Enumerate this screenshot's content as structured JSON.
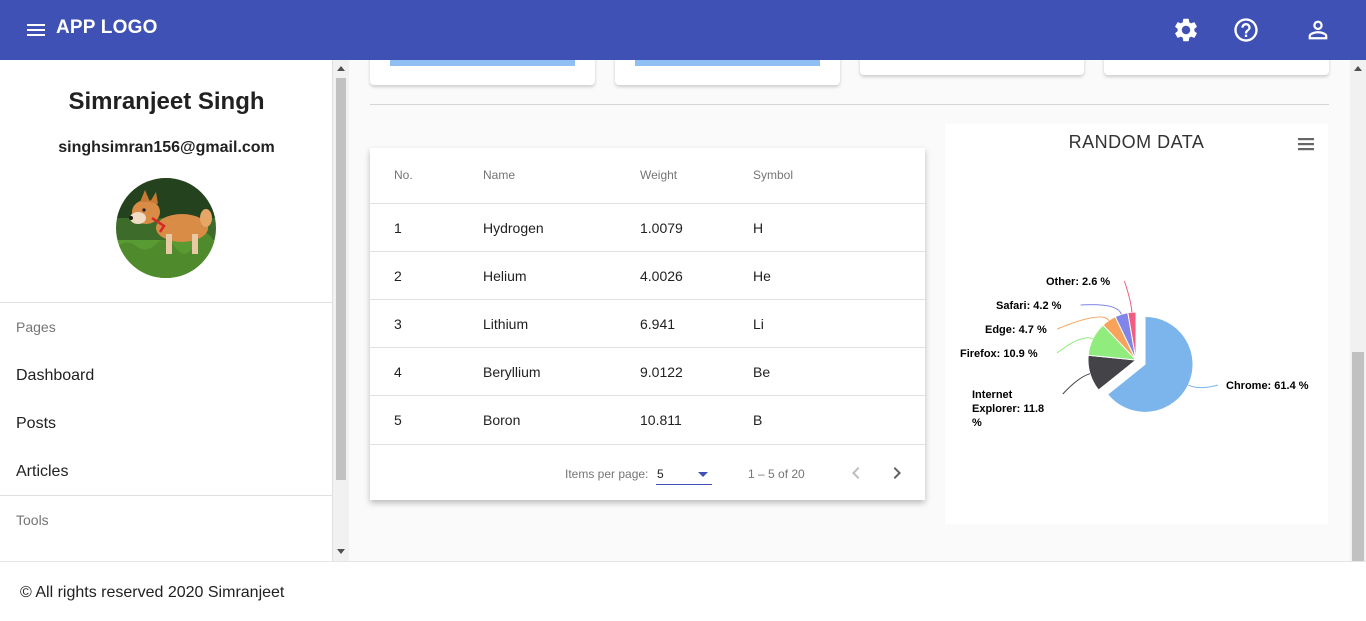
{
  "header": {
    "app_logo": "APP LOGO",
    "icons": [
      "menu-icon",
      "settings-icon",
      "help-icon",
      "account-icon"
    ],
    "color": "#3f51b5"
  },
  "sidebar": {
    "profile": {
      "name": "Simranjeet Singh",
      "email": "singhsimran156@gmail.com"
    },
    "pages_header": "Pages",
    "items": [
      "Dashboard",
      "Posts",
      "Articles"
    ],
    "tools_header": "Tools"
  },
  "table": {
    "columns": [
      "No.",
      "Name",
      "Weight",
      "Symbol"
    ],
    "rows": [
      [
        "1",
        "Hydrogen",
        "1.0079",
        "H"
      ],
      [
        "2",
        "Helium",
        "4.0026",
        "He"
      ],
      [
        "3",
        "Lithium",
        "6.941",
        "Li"
      ],
      [
        "4",
        "Beryllium",
        "9.0122",
        "Be"
      ],
      [
        "5",
        "Boron",
        "10.811",
        "B"
      ]
    ],
    "paginator": {
      "label": "Items per page:",
      "page_size": "5",
      "range": "1 – 5 of 20"
    }
  },
  "chart_data": {
    "type": "pie",
    "title": "RANDOM DATA",
    "categories": [
      "Chrome",
      "Internet Explorer",
      "Firefox",
      "Edge",
      "Safari",
      "Other"
    ],
    "values": [
      61.4,
      11.8,
      10.9,
      4.7,
      4.2,
      2.6
    ],
    "labels": [
      "Chrome: 61.4 %",
      "Internet Explorer: 11.8 %",
      "Firefox: 10.9 %",
      "Edge: 4.7 %",
      "Safari: 4.2 %",
      "Other: 2.6 %"
    ],
    "colors": [
      "#7cb5ec",
      "#434348",
      "#90ed7d",
      "#f7a35c",
      "#8085e9",
      "#f15c80"
    ],
    "sliced": "Chrome"
  },
  "footer": {
    "text": "© All rights reserved 2020 Simranjeet"
  }
}
